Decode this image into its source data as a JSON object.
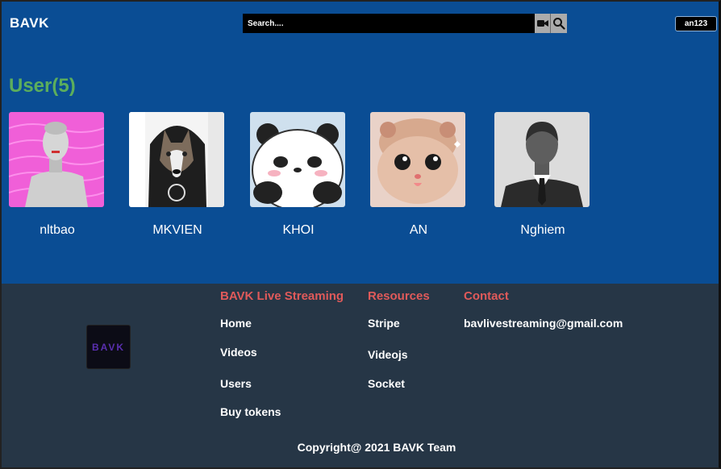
{
  "header": {
    "brand": "BAVK",
    "search_placeholder": "Search....",
    "video_icon": "video-camera-icon",
    "search_icon": "magnifier-icon",
    "user_label": "an123"
  },
  "main": {
    "title": "User(5)",
    "users": [
      {
        "name": "nltbao"
      },
      {
        "name": "MKVIEN"
      },
      {
        "name": "KHOI"
      },
      {
        "name": "AN"
      },
      {
        "name": "Nghiem"
      }
    ]
  },
  "footer": {
    "logo_text": "BAVK",
    "col1_title": "BAVK Live Streaming",
    "col1_links": [
      "Home",
      "Videos",
      "Users",
      "Buy tokens"
    ],
    "col2_title": "Resources",
    "col2_links": [
      "Stripe",
      "Videojs",
      "Socket"
    ],
    "col3_title": "Contact",
    "col3_email": "bavlivestreaming@gmail.com",
    "copyright": "Copyright@ 2021 BAVK Team"
  },
  "colors": {
    "page_bg": "#0a4d94",
    "footer_bg": "#263646",
    "title_green": "#5cae5c",
    "footer_heading": "#e05a5a"
  }
}
